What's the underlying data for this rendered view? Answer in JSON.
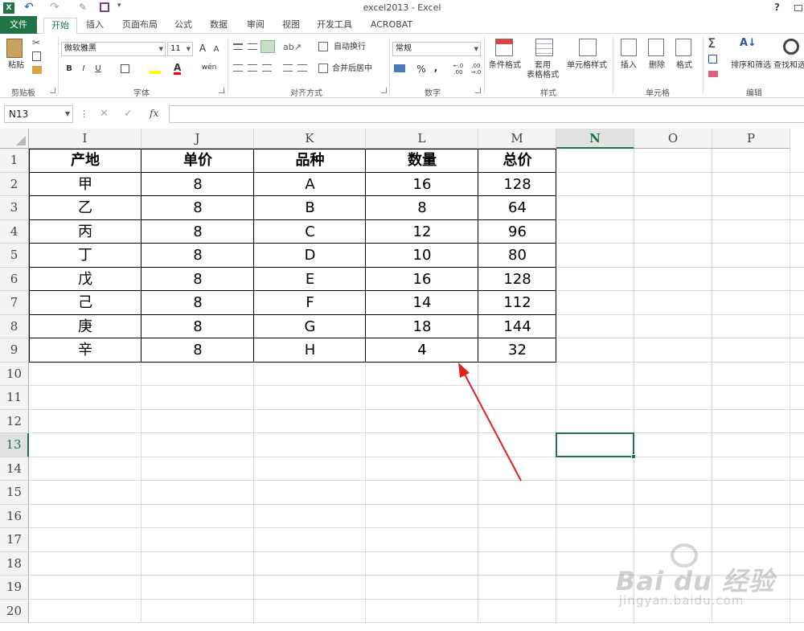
{
  "window": {
    "title": "excel2013 - Excel",
    "help": "?"
  },
  "tabs": [
    "文件",
    "开始",
    "插入",
    "页面布局",
    "公式",
    "数据",
    "审阅",
    "视图",
    "开发工具",
    "ACROBAT"
  ],
  "ribbon": {
    "clipboard": {
      "label": "剪贴板",
      "paste": "粘贴"
    },
    "font": {
      "label": "字体",
      "family": "微软雅黑",
      "size": "11",
      "bold": "B",
      "italic": "I",
      "underline": "U",
      "grow": "A",
      "shrink": "A",
      "pinyin": "wén"
    },
    "alignment": {
      "label": "对齐方式",
      "wrap": "自动换行",
      "merge": "合并后居中"
    },
    "number": {
      "label": "数字",
      "format": "常规",
      "percent": "%",
      "comma": ",",
      "inc": "←.0 .00",
      "dec": ".00 →.0"
    },
    "styles": {
      "label": "样式",
      "cond": "条件格式",
      "table": "套用\n表格格式",
      "cell": "单元格样式"
    },
    "cells": {
      "label": "单元格",
      "insert": "插入",
      "delete": "删除",
      "format": "格式"
    },
    "editing": {
      "label": "编辑",
      "sort": "排序和筛选",
      "find": "查找和选"
    }
  },
  "formula_bar": {
    "name_box": "N13",
    "fx": "fx",
    "cancel": "✕",
    "enter": "✓",
    "value": ""
  },
  "columns": [
    "I",
    "J",
    "K",
    "L",
    "M",
    "N",
    "O",
    "P"
  ],
  "selected_column": "N",
  "selected_row": "13",
  "rows": [
    "1",
    "2",
    "3",
    "4",
    "5",
    "6",
    "7",
    "8",
    "9",
    "10",
    "11",
    "12",
    "13",
    "14",
    "15",
    "16",
    "17",
    "18",
    "19",
    "20"
  ],
  "table": {
    "headers": [
      "产地",
      "单价",
      "品种",
      "数量",
      "总价"
    ],
    "rows": [
      [
        "甲",
        "8",
        "A",
        "16",
        "128"
      ],
      [
        "乙",
        "8",
        "B",
        "8",
        "64"
      ],
      [
        "丙",
        "8",
        "C",
        "12",
        "96"
      ],
      [
        "丁",
        "8",
        "D",
        "10",
        "80"
      ],
      [
        "戊",
        "8",
        "E",
        "16",
        "128"
      ],
      [
        "己",
        "8",
        "F",
        "14",
        "112"
      ],
      [
        "庚",
        "8",
        "G",
        "18",
        "144"
      ],
      [
        "辛",
        "8",
        "H",
        "4",
        "32"
      ]
    ]
  },
  "watermark": {
    "brand": "Bai du 经验",
    "url": "jingyan.baidu.com"
  },
  "colors": {
    "accent": "#217346",
    "arrow": "#e02020"
  }
}
